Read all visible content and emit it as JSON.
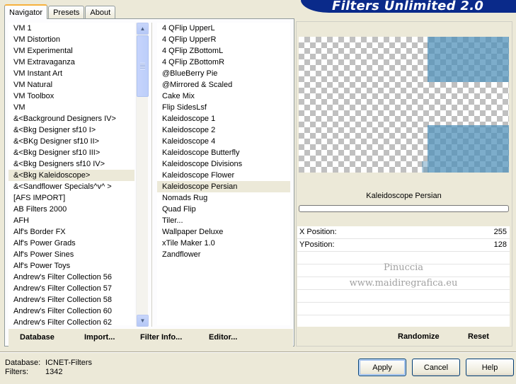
{
  "tabs": [
    {
      "label": "Navigator",
      "active": true
    },
    {
      "label": "Presets",
      "active": false
    },
    {
      "label": "About",
      "active": false
    }
  ],
  "banner_title": "Filters Unlimited 2.0",
  "categories": [
    "VM 1",
    "VM Distortion",
    "VM Experimental",
    "VM Extravaganza",
    "VM Instant Art",
    "VM Natural",
    "VM Toolbox",
    "VM",
    "&<Background Designers IV>",
    "&<Bkg Designer sf10 I>",
    "&<BKg Designer sf10 II>",
    "&<Bkg Designer sf10 III>",
    "&<Bkg Designers sf10 IV>",
    "&<Bkg Kaleidoscope>",
    "&<Sandflower Specials^v^ >",
    "[AFS IMPORT]",
    "AB Filters 2000",
    "AFH",
    "Alf's Border FX",
    "Alf's Power Grads",
    "Alf's Power Sines",
    "Alf's Power Toys",
    "Andrew's Filter Collection 56",
    "Andrew's Filter Collection 57",
    "Andrew's Filter Collection 58",
    "Andrew's Filter Collection 60",
    "Andrew's Filter Collection 62"
  ],
  "selected_category": "&<Bkg Kaleidoscope>",
  "filters": [
    "4 QFlip UpperL",
    "4 QFlip UpperR",
    "4 QFlip ZBottomL",
    "4 QFlip ZBottomR",
    "@BlueBerry Pie",
    "@Mirrored & Scaled",
    "Cake Mix",
    "Flip SidesLsf",
    "Kaleidoscope 1",
    "Kaleidoscope 2",
    "Kaleidoscope 4",
    "Kaleidoscope Butterfly",
    "Kaleidoscope Divisions",
    "Kaleidoscope Flower",
    "Kaleidoscope Persian",
    "Nomads Rug",
    "Quad Flip",
    "Tiler...",
    "Wallpaper Deluxe",
    "xTile Maker 1.0",
    "Zandflower"
  ],
  "selected_filter": "Kaleidoscope Persian",
  "bottom_buttons": {
    "database": "Database",
    "import": "Import...",
    "filter_info": "Filter Info...",
    "editor": "Editor..."
  },
  "current_filter_name": "Kaleidoscope Persian",
  "params": [
    {
      "label": "X Position:",
      "value": "255"
    },
    {
      "label": "YPosition:",
      "value": "128"
    }
  ],
  "watermark": {
    "line1": "Pinuccia",
    "line2": "www.maidiregrafica.eu"
  },
  "right_buttons": {
    "randomize": "Randomize",
    "reset": "Reset"
  },
  "status": {
    "database_label": "Database:",
    "database_value": "ICNET-Filters",
    "filters_label": "Filters:",
    "filters_value": "1342"
  },
  "dialog_buttons": {
    "apply": "Apply",
    "cancel": "Cancel",
    "help": "Help"
  },
  "colors": {
    "preview_tint": "#5291b9",
    "selection": "#ece9d8",
    "banner": "#0a2a8a"
  }
}
